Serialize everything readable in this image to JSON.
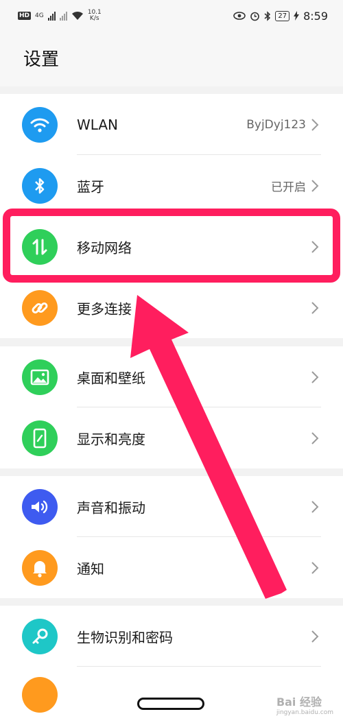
{
  "status_bar": {
    "hd": "HD",
    "network": "4G",
    "speed_value": "10.1",
    "speed_unit": "K/s",
    "battery": "27",
    "time": "8:59"
  },
  "header": {
    "title": "设置"
  },
  "settings": {
    "items": [
      {
        "label": "WLAN",
        "value": "ByjDyj123",
        "icon": "wifi-icon",
        "color": "#1e9bf0"
      },
      {
        "label": "蓝牙",
        "value": "已开启",
        "icon": "bluetooth-icon",
        "color": "#1e9bf0"
      },
      {
        "label": "移动网络",
        "value": "",
        "icon": "mobile-data-icon",
        "color": "#2fcf5a"
      },
      {
        "label": "更多连接",
        "value": "",
        "icon": "link-icon",
        "color": "#ff9a1e"
      },
      {
        "label": "桌面和壁纸",
        "value": "",
        "icon": "image-icon",
        "color": "#2fcf5a"
      },
      {
        "label": "显示和亮度",
        "value": "",
        "icon": "phone-brightness-icon",
        "color": "#2fcf5a"
      },
      {
        "label": "声音和振动",
        "value": "",
        "icon": "speaker-icon",
        "color": "#3e5bf0"
      },
      {
        "label": "通知",
        "value": "",
        "icon": "bell-icon",
        "color": "#ff9a1e"
      },
      {
        "label": "生物识别和密码",
        "value": "",
        "icon": "key-icon",
        "color": "#1ec7c7"
      }
    ]
  },
  "watermark": {
    "text": "Bai 经验",
    "sub": "jingyan.baidu.com"
  },
  "colors": {
    "highlight": "#ff1e5e",
    "arrow": "#ff1e5e"
  }
}
